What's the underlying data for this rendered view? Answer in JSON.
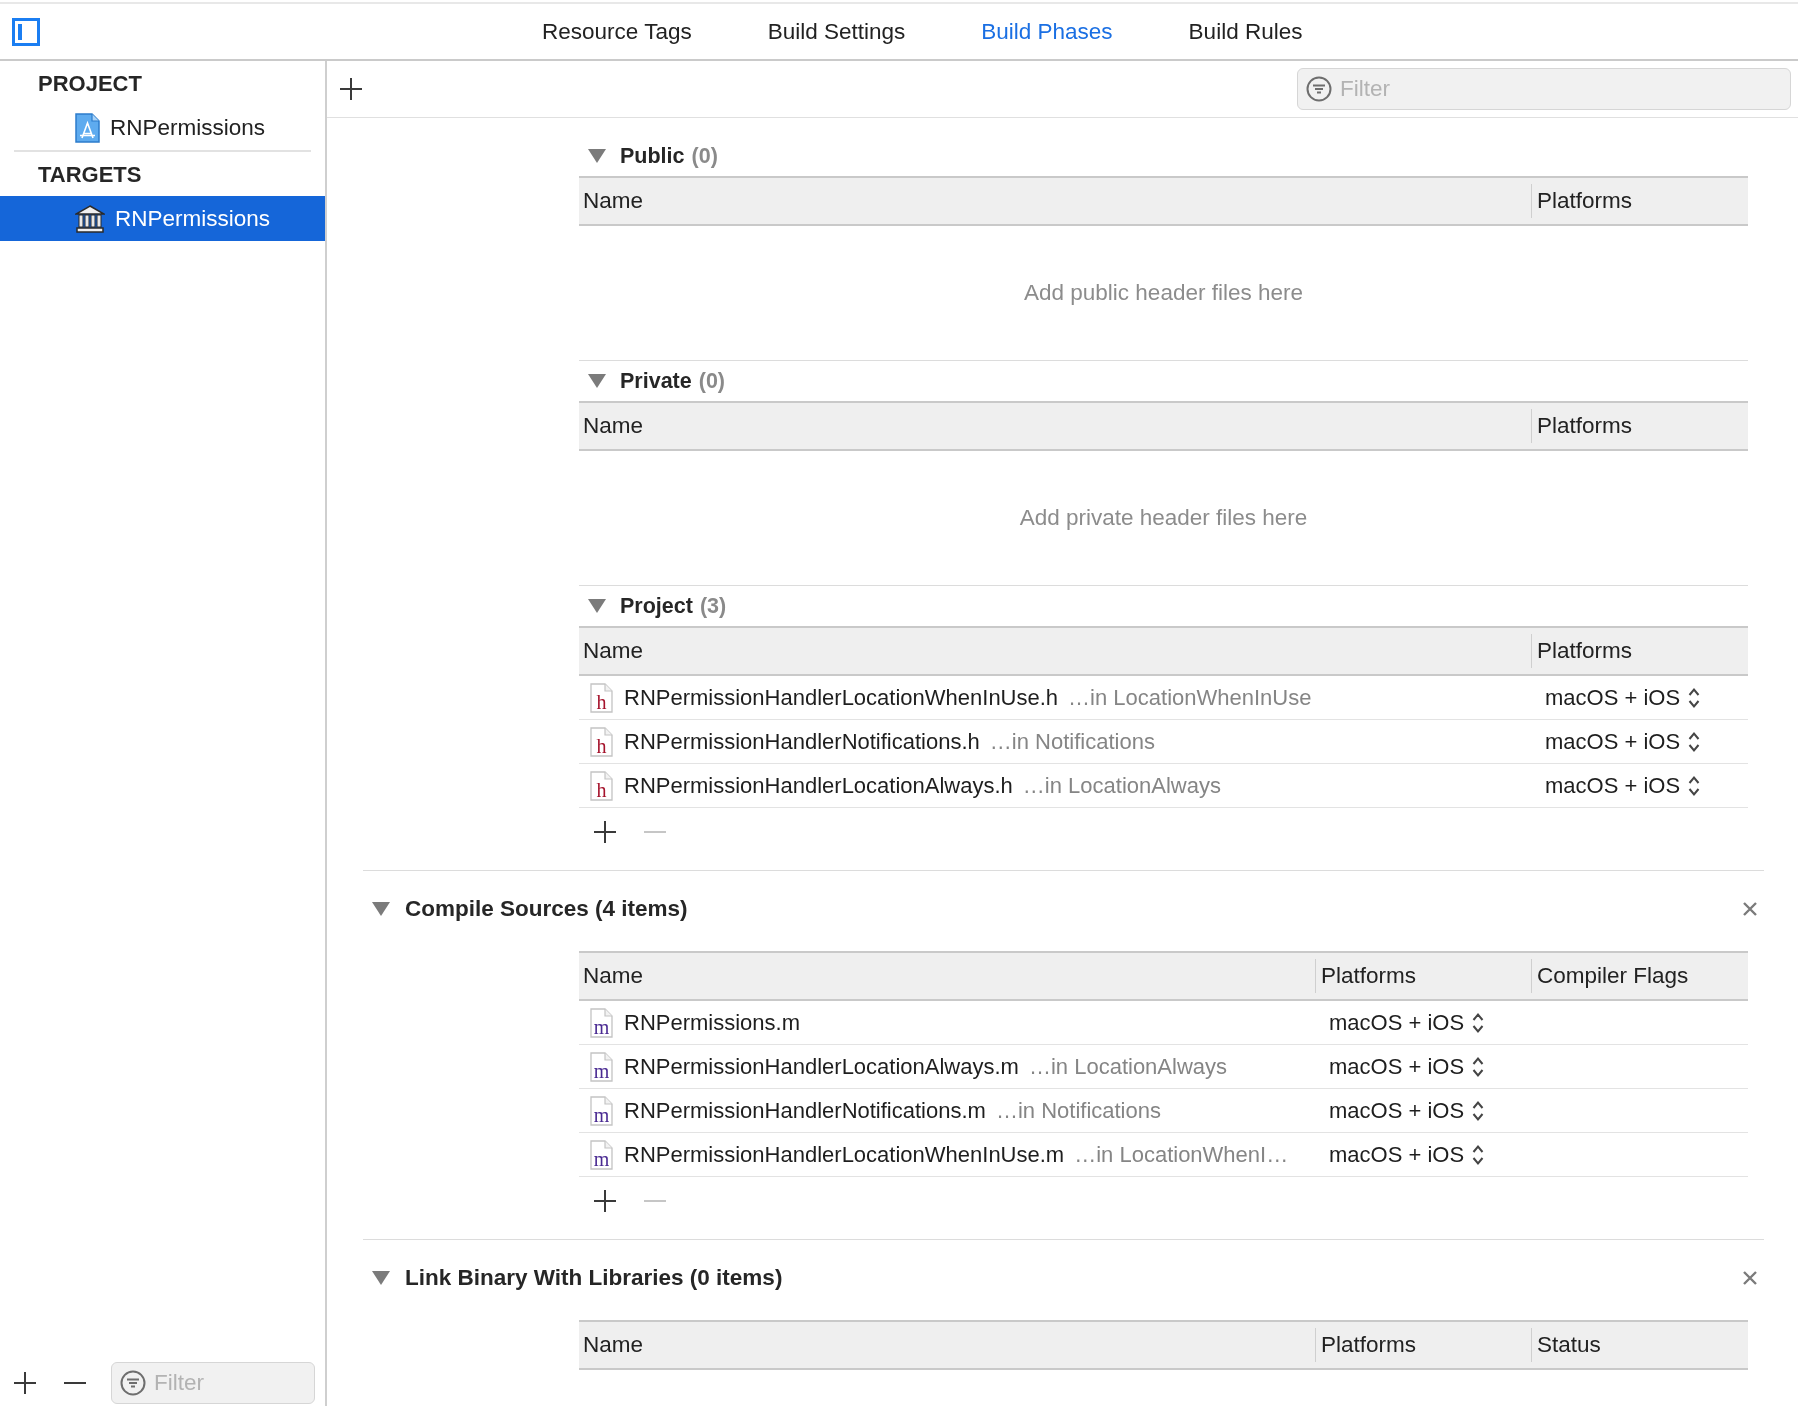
{
  "toolbar": {
    "tabs": [
      {
        "label": "Resource Tags",
        "selected": false
      },
      {
        "label": "Build Settings",
        "selected": false
      },
      {
        "label": "Build Phases",
        "selected": true
      },
      {
        "label": "Build Rules",
        "selected": false
      }
    ]
  },
  "sidebar": {
    "groups": [
      {
        "heading": "PROJECT",
        "items": [
          {
            "label": "RNPermissions",
            "kind": "project",
            "selected": false
          }
        ]
      },
      {
        "heading": "TARGETS",
        "items": [
          {
            "label": "RNPermissions",
            "kind": "target",
            "selected": true
          }
        ]
      }
    ],
    "footer": {
      "remove_disabled": false,
      "filter": {
        "placeholder": "Filter"
      }
    }
  },
  "editor": {
    "filter": {
      "placeholder": "Filter"
    },
    "header_groups": [
      {
        "title": "Public",
        "count": "(0)",
        "expanded": true,
        "columns": [
          "Name",
          "Platforms"
        ],
        "empty_text": "Add public header files here"
      },
      {
        "title": "Private",
        "count": "(0)",
        "expanded": true,
        "columns": [
          "Name",
          "Platforms"
        ],
        "empty_text": "Add private header files here"
      },
      {
        "title": "Project",
        "count": "(3)",
        "expanded": true,
        "columns": [
          "Name",
          "Platforms"
        ],
        "rows": [
          {
            "kind": "header",
            "file_type": "h",
            "name": "RNPermissionHandlerLocationWhenInUse.h",
            "location": "…in LocationWhenInUse",
            "platforms": "macOS + iOS"
          },
          {
            "kind": "header",
            "file_type": "h",
            "name": "RNPermissionHandlerNotifications.h",
            "location": "…in Notifications",
            "platforms": "macOS + iOS"
          },
          {
            "kind": "header",
            "file_type": "h",
            "name": "RNPermissionHandlerLocationAlways.h",
            "location": "…in LocationAlways",
            "platforms": "macOS + iOS"
          }
        ],
        "controls": {
          "remove_disabled": true
        }
      }
    ],
    "phases": [
      {
        "title": "Compile Sources (4 items)",
        "expanded": true,
        "columns": [
          "Name",
          "Platforms",
          "Compiler Flags"
        ],
        "rows": [
          {
            "kind": "source",
            "file_type": "m",
            "name": "RNPermissions.m",
            "platforms": "macOS + iOS"
          },
          {
            "kind": "source",
            "file_type": "m",
            "name": "RNPermissionHandlerLocationAlways.m",
            "location": "…in LocationAlways",
            "platforms": "macOS + iOS"
          },
          {
            "kind": "source",
            "file_type": "m",
            "name": "RNPermissionHandlerNotifications.m",
            "location": "…in Notifications",
            "platforms": "macOS + iOS"
          },
          {
            "kind": "source",
            "file_type": "m",
            "name": "RNPermissionHandlerLocationWhenInUse.m",
            "location": "…in LocationWhenI…",
            "platforms": "macOS + iOS"
          }
        ],
        "controls": {
          "remove_disabled": true
        }
      },
      {
        "title": "Link Binary With Libraries (0 items)",
        "expanded": true,
        "columns": [
          "Name",
          "Platforms",
          "Status"
        ]
      }
    ]
  }
}
